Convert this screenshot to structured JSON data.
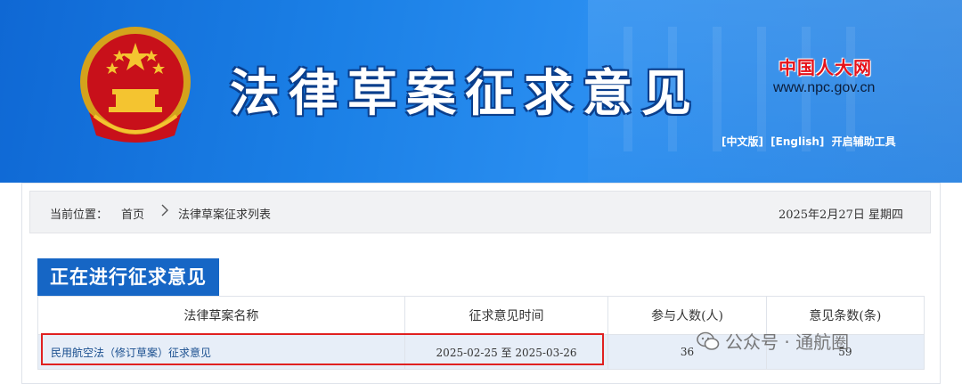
{
  "banner": {
    "site_title": "法律草案征求意见",
    "npc_logo": "中国人大网",
    "npc_url": "www.npc.gov.cn",
    "lang_links": [
      "[中文版]",
      "[English]",
      "开启辅助工具"
    ]
  },
  "breadcrumb": {
    "label": "当前位置：",
    "home": "首页",
    "current": "法律草案征求列表",
    "date": "2025年2月27日  星期四"
  },
  "section": {
    "title": "正在进行征求意见"
  },
  "table": {
    "headers": [
      "法律草案名称",
      "征求意见时间",
      "参与人数(人)",
      "意见条数(条)"
    ],
    "rows": [
      {
        "name": "民用航空法（修订草案）征求意见",
        "period": "2025-02-25  至  2025-03-26",
        "participants": "36",
        "opinions": "59"
      }
    ]
  },
  "watermark": {
    "text": "公众号 · 通航圈"
  },
  "colors": {
    "banner_blue": "#1b80e6",
    "section_blue": "#1666c5",
    "highlight_red": "#e02020"
  }
}
